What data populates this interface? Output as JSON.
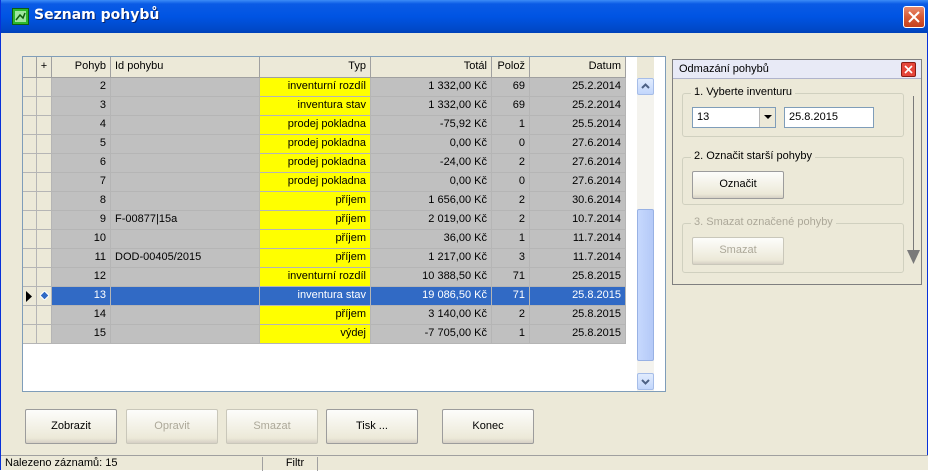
{
  "window": {
    "title": "Seznam pohybů"
  },
  "grid": {
    "columns": [
      "+",
      "Pohyb",
      "Id pohybu",
      "Typ",
      "Totál",
      "Polož",
      "Datum"
    ],
    "rows": [
      {
        "pohyb": "2",
        "id": "",
        "typ": "inventurní rozdíl",
        "total": "1 332,00 Kč",
        "poloz": "69",
        "datum": "25.2.2014"
      },
      {
        "pohyb": "3",
        "id": "",
        "typ": "inventura stav",
        "total": "1 332,00 Kč",
        "poloz": "69",
        "datum": "25.2.2014"
      },
      {
        "pohyb": "4",
        "id": "",
        "typ": "prodej pokladna",
        "total": "-75,92 Kč",
        "poloz": "1",
        "datum": "25.5.2014"
      },
      {
        "pohyb": "5",
        "id": "",
        "typ": "prodej pokladna",
        "total": "0,00 Kč",
        "poloz": "0",
        "datum": "27.6.2014"
      },
      {
        "pohyb": "6",
        "id": "",
        "typ": "prodej pokladna",
        "total": "-24,00 Kč",
        "poloz": "2",
        "datum": "27.6.2014"
      },
      {
        "pohyb": "7",
        "id": "",
        "typ": "prodej pokladna",
        "total": "0,00 Kč",
        "poloz": "0",
        "datum": "27.6.2014"
      },
      {
        "pohyb": "8",
        "id": "",
        "typ": "příjem",
        "total": "1 656,00 Kč",
        "poloz": "2",
        "datum": "30.6.2014"
      },
      {
        "pohyb": "9",
        "id": "F-00877|15a",
        "typ": "příjem",
        "total": "2 019,00 Kč",
        "poloz": "2",
        "datum": "10.7.2014"
      },
      {
        "pohyb": "10",
        "id": "",
        "typ": "příjem",
        "total": "36,00 Kč",
        "poloz": "1",
        "datum": "11.7.2014"
      },
      {
        "pohyb": "11",
        "id": "DOD-00405/2015",
        "typ": "příjem",
        "total": "1 217,00 Kč",
        "poloz": "3",
        "datum": "11.7.2014"
      },
      {
        "pohyb": "12",
        "id": "",
        "typ": "inventurní rozdíl",
        "total": "10 388,50 Kč",
        "poloz": "71",
        "datum": "25.8.2015"
      },
      {
        "pohyb": "13",
        "id": "",
        "typ": "inventura stav",
        "total": "19 086,50 Kč",
        "poloz": "71",
        "datum": "25.8.2015",
        "selected": true
      },
      {
        "pohyb": "14",
        "id": "",
        "typ": "příjem",
        "total": "3 140,00 Kč",
        "poloz": "2",
        "datum": "25.8.2015"
      },
      {
        "pohyb": "15",
        "id": "",
        "typ": "výdej",
        "total": "-7 705,00 Kč",
        "poloz": "1",
        "datum": "25.8.2015"
      }
    ]
  },
  "buttons": {
    "zobrazit": "Zobrazit",
    "opravit": "Opravit",
    "smazat": "Smazat",
    "tisk": "Tisk ...",
    "konec": "Konec"
  },
  "panel": {
    "title": "Odmazání pohybů",
    "step1": "1. Vyberte inventuru",
    "inventura_value": "13",
    "inventura_date": "25.8.2015",
    "step2": "2. Označit starší pohyby",
    "oznacit": "Označit",
    "step3": "3. Smazat označené pohyby",
    "smazat": "Smazat"
  },
  "status": {
    "count": "Nalezeno záznamů: 15",
    "filtr": "Filtr"
  },
  "colors": {
    "title_bar": "#0054e3",
    "typ_highlight": "#ffff00",
    "row_background": "#c0c0c0",
    "selected_row": "#316ac5"
  }
}
